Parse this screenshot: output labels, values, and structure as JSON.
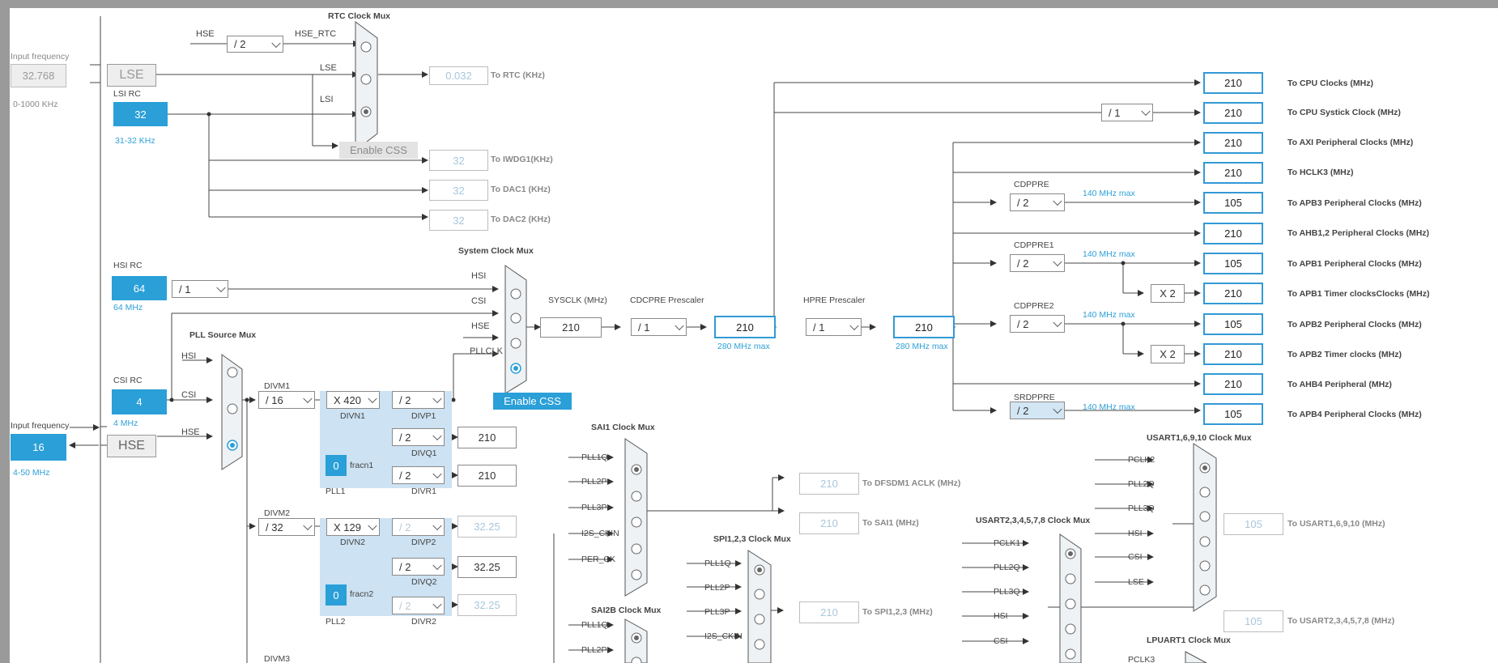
{
  "rtc": {
    "title": "RTC Clock Mux",
    "hse_label": "HSE",
    "hse_div": "/ 2",
    "hse_rtc": "HSE_RTC",
    "in_lse": "LSE",
    "in_lsi": "LSI",
    "enable_css": "Enable CSS",
    "out_value": "0.032",
    "out_label": "To RTC (KHz)"
  },
  "lse": {
    "input_label": "Input frequency",
    "input_value": "32.768",
    "range": "0-1000 KHz",
    "name": "LSE"
  },
  "lsi": {
    "name": "LSI RC",
    "value": "32",
    "range": "31-32 KHz"
  },
  "lsi_outputs": [
    {
      "value": "32",
      "label": "To IWDG1(KHz)"
    },
    {
      "value": "32",
      "label": "To DAC1 (KHz)"
    },
    {
      "value": "32",
      "label": "To DAC2 (KHz)"
    }
  ],
  "hsi": {
    "name": "HSI RC",
    "value": "64",
    "range": "64 MHz",
    "div": "/ 1"
  },
  "csi": {
    "name": "CSI RC",
    "value": "4",
    "range": "4 MHz"
  },
  "hse": {
    "input_label": "Input frequency",
    "input_value": "16",
    "range": "4-50 MHz",
    "name": "HSE"
  },
  "pll_mux": {
    "title": "PLL Source Mux",
    "in_hsi": "HSI",
    "in_csi": "CSI",
    "in_hse": "HSE"
  },
  "pll1": {
    "divm_label": "DIVM1",
    "divm": "/ 16",
    "divn": "X 420",
    "divn_label": "DIVN1",
    "divp": "/ 2",
    "divp_label": "DIVP1",
    "divq": "/ 2",
    "divq_label": "DIVQ1",
    "divq_out": "210",
    "divr": "/ 2",
    "divr_label": "DIVR1",
    "divr_out": "210",
    "frac": "0",
    "frac_label": "fracn1",
    "name": "PLL1"
  },
  "pll2": {
    "divm_label": "DIVM2",
    "divm": "/ 32",
    "divn": "X 129",
    "divn_label": "DIVN2",
    "divp": "/ 2",
    "divp_label": "DIVP2",
    "divp_out": "32.25",
    "divq": "/ 2",
    "divq_label": "DIVQ2",
    "divq_out": "32.25",
    "divr": "/ 2",
    "divr_label": "DIVR2",
    "divr_out": "32.25",
    "frac": "0",
    "frac_label": "fracn2",
    "name": "PLL2"
  },
  "pll3": {
    "divm_label": "DIVM3"
  },
  "sysmux": {
    "title": "System Clock Mux",
    "in_hsi": "HSI",
    "in_csi": "CSI",
    "in_hse": "HSE",
    "in_pll": "PLLCLK",
    "enable_css": "Enable CSS"
  },
  "sysclk": {
    "label": "SYSCLK (MHz)",
    "value": "210",
    "cdcpre_label": "CDCPRE Prescaler",
    "cdcpre": "/ 1",
    "cpu_value": "210",
    "cpu_max": "280 MHz max",
    "hpre_label": "HPRE Prescaler",
    "hpre": "/ 1",
    "hclk_value": "210",
    "hclk_max": "280 MHz max"
  },
  "systick": {
    "div": "/ 1"
  },
  "outputs": [
    {
      "value": "210",
      "label": "To CPU Clocks (MHz)"
    },
    {
      "value": "210",
      "label": "To CPU Systick Clock (MHz)"
    },
    {
      "value": "210",
      "label": "To AXI Peripheral Clocks (MHz)"
    },
    {
      "value": "210",
      "label": "To HCLK3 (MHz)"
    },
    {
      "value": "105",
      "label": "To APB3 Peripheral Clocks (MHz)"
    },
    {
      "value": "210",
      "label": "To AHB1,2 Peripheral Clocks (MHz)"
    },
    {
      "value": "105",
      "label": "To APB1 Peripheral Clocks (MHz)"
    },
    {
      "value": "210",
      "label": "To APB1 Timer clocksClocks (MHz)"
    },
    {
      "value": "105",
      "label": "To APB2 Peripheral Clocks (MHz)"
    },
    {
      "value": "210",
      "label": "To APB2 Timer clocks (MHz)"
    },
    {
      "value": "210",
      "label": "To AHB4 Peripheral (MHz)"
    },
    {
      "value": "105",
      "label": "To APB4 Peripheral Clocks (MHz)"
    }
  ],
  "prescalers": {
    "cdppre": {
      "label": "CDPPRE",
      "value": "/ 2",
      "max": "140 MHz max"
    },
    "cdppre1": {
      "label": "CDPPRE1",
      "value": "/ 2",
      "max": "140 MHz max",
      "timer": "X 2"
    },
    "cdppre2": {
      "label": "CDPPRE2",
      "value": "/ 2",
      "max": "140 MHz max",
      "timer": "X 2"
    },
    "srdppre": {
      "label": "SRDPPRE",
      "value": "/ 2",
      "max": "140 MHz max"
    }
  },
  "sai1": {
    "title": "SAI1 Clock Mux",
    "inputs": [
      "PLL1Q",
      "PLL2P",
      "PLL3P",
      "I2S_CKIN",
      "PER_CK"
    ]
  },
  "dfsdm": {
    "value": "210",
    "label": "To DFSDM1 ACLK (MHz)"
  },
  "sai_out": {
    "value": "210",
    "label": "To SAI1 (MHz)"
  },
  "spi": {
    "title": "SPI1,2,3 Clock Mux",
    "inputs": [
      "PLL1Q",
      "PLL2P",
      "PLL3P",
      "I2S_CKIN"
    ],
    "out_value": "210",
    "out_label": "To SPI1,2,3 (MHz)"
  },
  "sai2b": {
    "title": "SAI2B Clock Mux",
    "inputs": [
      "PLL1Q",
      "PLL2P"
    ]
  },
  "usart1": {
    "title": "USART1,6,9,10 Clock Mux",
    "inputs": [
      "PCLK2",
      "PLL2Q",
      "PLL3Q",
      "HSI",
      "CSI",
      "LSE"
    ],
    "out_value": "105",
    "out_label": "To USART1,6,9,10 (MHz)"
  },
  "usart2": {
    "title": "USART2,3,4,5,7,8 Clock Mux",
    "inputs": [
      "PCLK1",
      "PLL2Q",
      "PLL3Q",
      "HSI",
      "CSI"
    ],
    "out_value": "105",
    "out_label": "To USART2,3,4,5,7,8 (MHz)"
  },
  "lpuart": {
    "title": "LPUART1 Clock Mux",
    "inputs": [
      "PCLK3"
    ]
  },
  "colors": {
    "accent": "#2a9fd8",
    "output_border": "#3399d5",
    "panel": "#cde2f2"
  }
}
